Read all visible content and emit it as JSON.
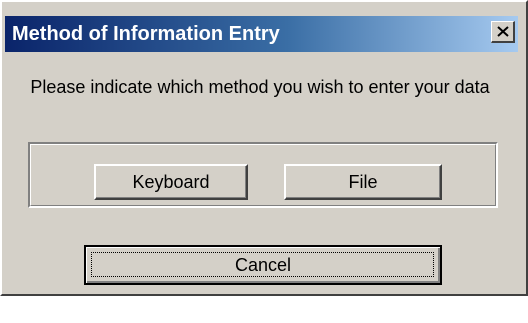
{
  "dialog": {
    "title": "Method of Information Entry",
    "close_icon": "close-icon",
    "prompt": "Please indicate which method you wish to enter your data",
    "buttons": {
      "keyboard": "Keyboard",
      "file": "File",
      "cancel": "Cancel"
    },
    "default_button": "cancel"
  },
  "colors": {
    "face": "#d4d0c8",
    "title_start": "#0a246a",
    "title_end": "#a6caf0",
    "title_text": "#ffffff"
  }
}
